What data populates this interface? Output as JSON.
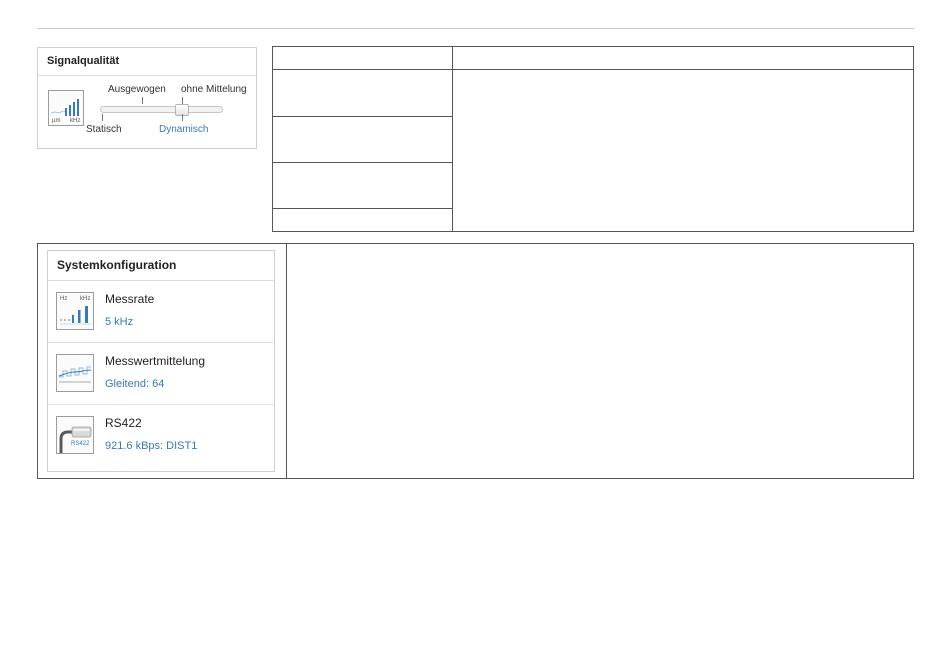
{
  "signal_quality": {
    "title": "Signalqualität",
    "icon_units": [
      "µm",
      "kHz"
    ],
    "slider_labels_top": [
      "Ausgewogen",
      "ohne Mittelung"
    ],
    "slider_labels_bottom": [
      "Statisch",
      "Dynamisch"
    ],
    "selected": "Dynamisch"
  },
  "system_config": {
    "title": "Systemkonfiguration",
    "items": [
      {
        "label": "Messrate",
        "value": "5 kHz",
        "icon": "measurement-rate-icon",
        "icon_text": [
          "Hz",
          "kHz"
        ]
      },
      {
        "label": "Messwertmittelung",
        "value": "Gleitend: 64",
        "icon": "averaging-icon"
      },
      {
        "label": "RS422",
        "value": "921.6 kBps: DIST1",
        "icon": "rs422-cable-icon",
        "icon_text": [
          "RS422"
        ]
      }
    ]
  },
  "colors": {
    "accent": "#3a78b8",
    "border": "#555555"
  }
}
